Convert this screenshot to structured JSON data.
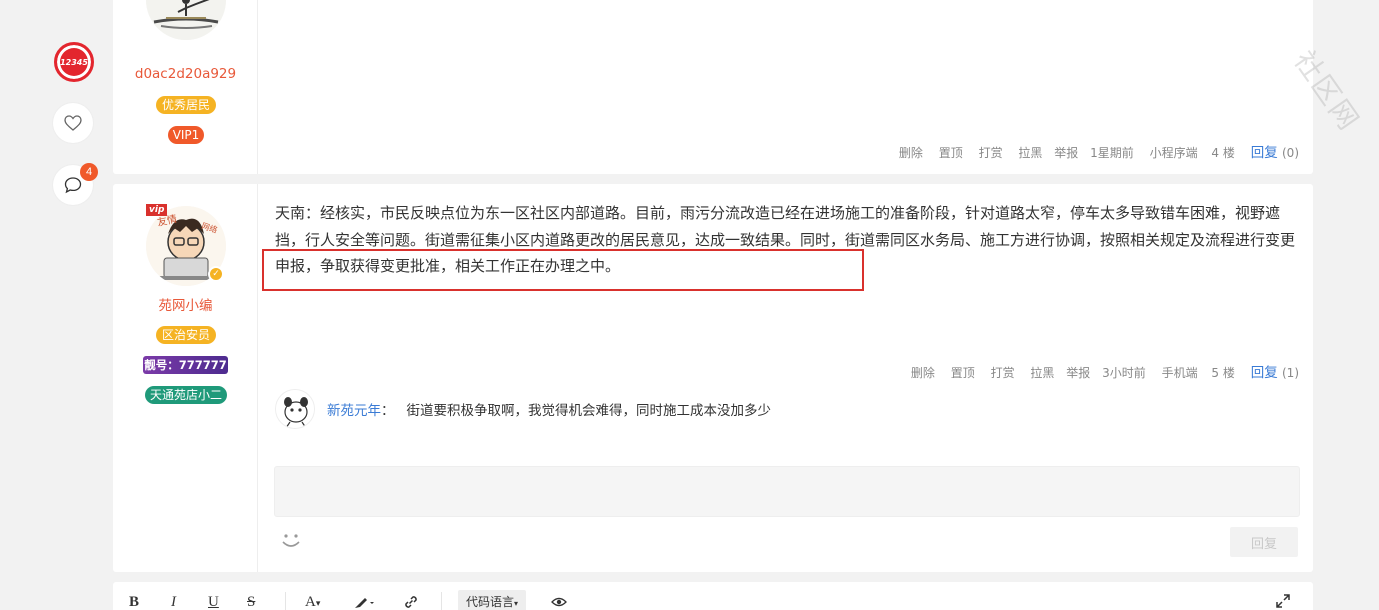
{
  "rail": {
    "logo_text": "12345",
    "comment_badge": "4"
  },
  "post1": {
    "username": "d0ac2d20a929",
    "tags": [
      "优秀居民",
      "VIP1"
    ],
    "actions": [
      "删除",
      "置顶",
      "打赏",
      "拉黑",
      "举报"
    ],
    "time": "1星期前",
    "client": "小程序端",
    "floor": "4 楼",
    "reply_label": "回复",
    "reply_count": "(0)"
  },
  "post2": {
    "username": "苑网小编",
    "vip_label": "vip",
    "tags": [
      "区治安员",
      "靓号：777777",
      "天通苑店小二"
    ],
    "content": "天南：经核实，市民反映点位为东一区社区内部道路。目前，雨污分流改造已经在进场施工的准备阶段，针对道路太窄，停车太多导致错车困难，视野遮挡，行人安全等问题。街道需征集小区内道路更改的居民意见，达成一致结果。同时，街道需同区水务局、施工方进行协调，按照相关规定及流程进行变更申报，争取获得变更批准，相关工作正在办理之中。",
    "actions": [
      "删除",
      "置顶",
      "打赏",
      "拉黑",
      "举报"
    ],
    "time": "3小时前",
    "client": "手机端",
    "floor": "5 楼",
    "reply_label": "回复",
    "reply_count": "(1)",
    "comment": {
      "author": "新苑元年",
      "separator": "：",
      "text": "街道要积极争取啊，我觉得机会难得，同时施工成本没加多少"
    },
    "submit_label": "回复"
  },
  "toolbar": {
    "bold": "B",
    "italic": "I",
    "underline": "U",
    "strike": "S",
    "font": "A",
    "code_lang": "代码语言"
  },
  "watermark": "社区网"
}
